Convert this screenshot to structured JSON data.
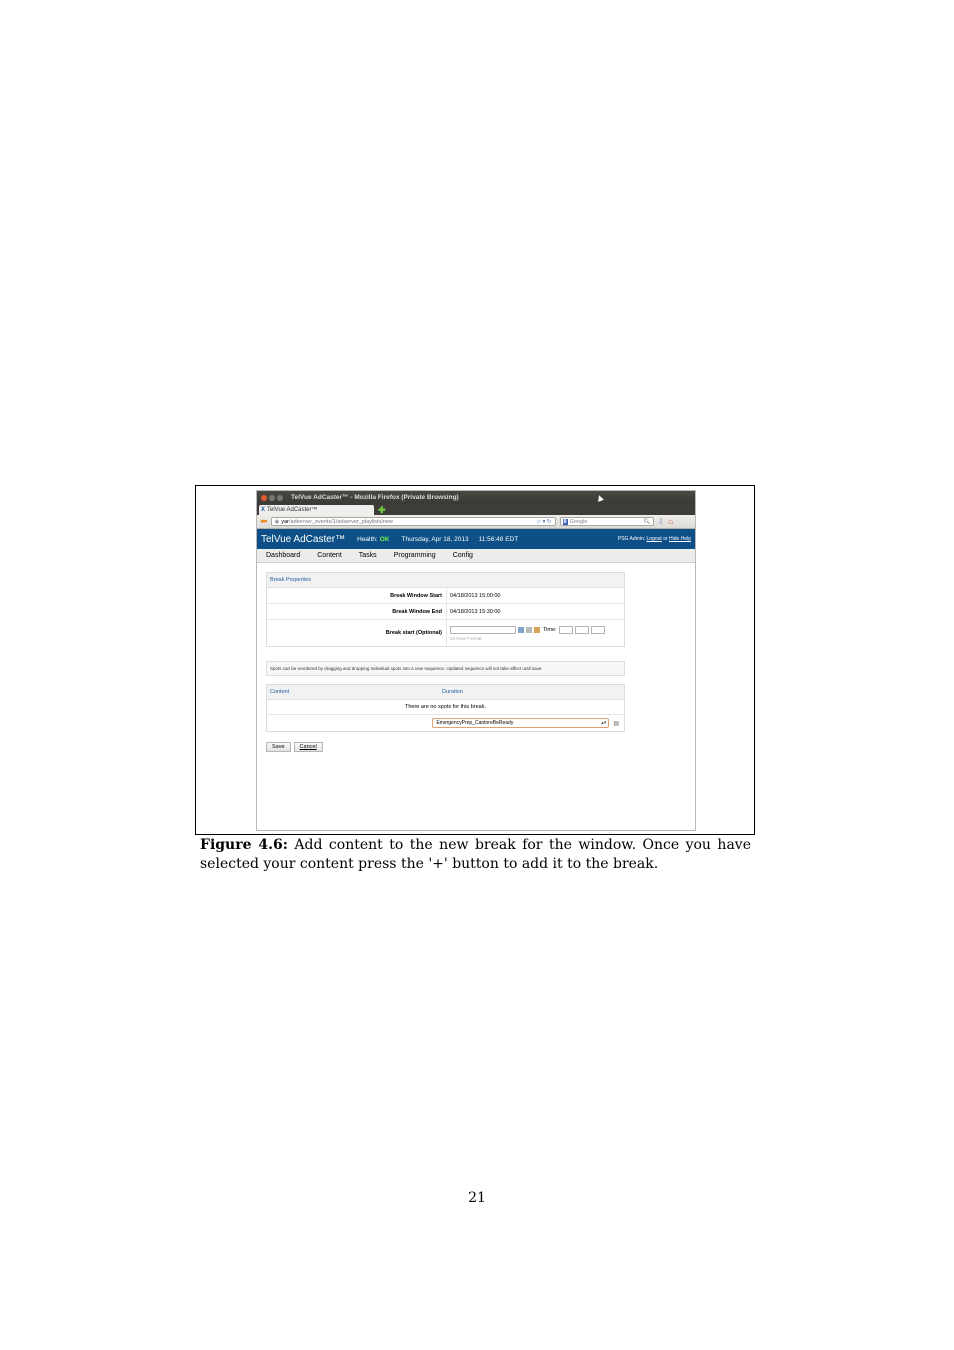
{
  "browser": {
    "window_title": "TelVue AdCaster™ - Mozilla Firefox (Private Browsing)",
    "tab_title": "TelVue AdCaster™",
    "new_tab": "✚",
    "url_host": "yar",
    "url_path": "/adserver_events/1/adserver_playlists/new",
    "search_placeholder": "Google"
  },
  "app": {
    "brand": "TelVue AdCaster™",
    "health_label": "Health:",
    "health_status": "OK",
    "date": "Thursday, Apr 18, 2013",
    "time": "11:56:48 EDT",
    "admin_user": "PSG Admin:",
    "logout": "Logout",
    "or": "or",
    "hide_help": "Hide Help",
    "health_color": "#6ff04a",
    "header_color": "#0d4f86"
  },
  "menu": [
    "Dashboard",
    "Content",
    "Tasks",
    "Programming",
    "Config"
  ],
  "break_properties": {
    "heading": "Break Properties",
    "rows": [
      {
        "label": "Break Window Start",
        "value": "04/18/2013 15:00:00"
      },
      {
        "label": "Break Window End",
        "value": "04/18/2013 15:30:00"
      }
    ],
    "optional_label": "Break start (Optional)",
    "time_label": "Time:",
    "format_hint": "24 Hour Format"
  },
  "notice": "Spots can be reordered by dragging and dropping individual spots into a new sequence. Updated sequence will not take affect until save.",
  "spots": {
    "col_content": "Content",
    "col_duration": "Duration",
    "empty_message": "There are no spots for this break.",
    "selected_content": "EmergencyPrep_CantoreBeReady"
  },
  "buttons": {
    "save": "Save",
    "cancel": "Cancel"
  },
  "caption": {
    "label": "Figure 4.6:",
    "text": "Add content to the new break for the window. Once you have selected your content press the '+' button to add it to the break."
  },
  "page_number": "21"
}
